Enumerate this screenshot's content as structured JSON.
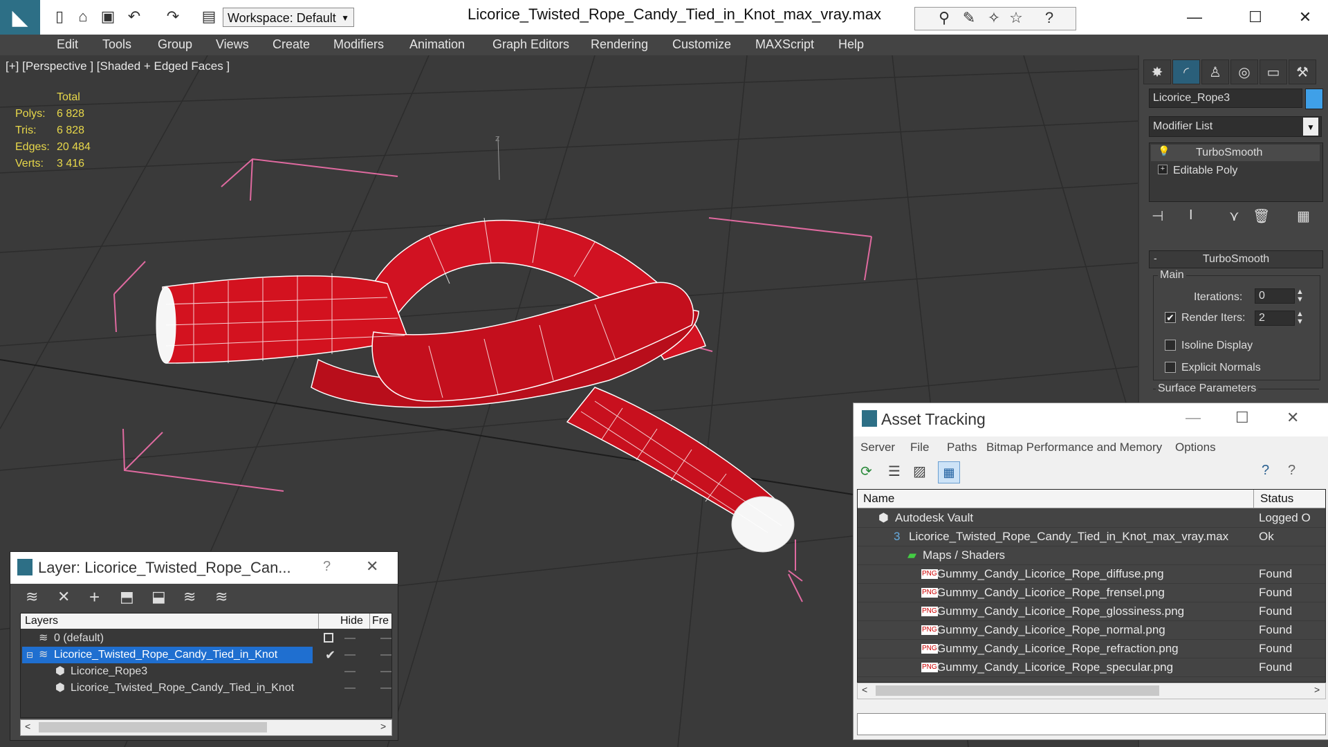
{
  "window": {
    "title": "Licorice_Twisted_Rope_Candy_Tied_in_Knot_max_vray.max",
    "workspace": "Workspace: Default",
    "minimize": "—",
    "maximize": "☐",
    "close": "✕"
  },
  "menu": [
    "Edit",
    "Tools",
    "Group",
    "Views",
    "Create",
    "Modifiers",
    "Animation",
    "Graph Editors",
    "Rendering",
    "Customize",
    "MAXScript",
    "Help"
  ],
  "viewport": {
    "label": "[+] [Perspective ] [Shaded + Edged Faces ]",
    "stats_header": "Total",
    "stats": [
      {
        "label": "Polys:",
        "value": "6 828"
      },
      {
        "label": "Tris:",
        "value": "6 828"
      },
      {
        "label": "Edges:",
        "value": "20 484"
      },
      {
        "label": "Verts:",
        "value": "3 416"
      }
    ],
    "axis_label": "z"
  },
  "command_panel": {
    "object_name": "Licorice_Rope3",
    "modifier_list": "Modifier List",
    "stack": [
      "TurboSmooth",
      "Editable Poly"
    ],
    "rollout_title": "TurboSmooth",
    "group_main": "Main",
    "iterations_label": "Iterations:",
    "iterations_value": "0",
    "render_iters_label": "Render Iters:",
    "render_iters_value": "2",
    "render_iters_checked": "✔",
    "isoline_label": "Isoline Display",
    "explicit_label": "Explicit Normals",
    "surface_label": "Surface Parameters",
    "colors": {
      "swatch": "#3fa0e8"
    }
  },
  "asset_tracking": {
    "title": "Asset Tracking",
    "menu": [
      "Server",
      "File",
      "Paths",
      "Bitmap Performance and Memory",
      "Options"
    ],
    "col_name": "Name",
    "col_status": "Status",
    "rows": [
      {
        "name": "Autodesk Vault",
        "status": "Logged O",
        "indent": 1
      },
      {
        "name": "Licorice_Twisted_Rope_Candy_Tied_in_Knot_max_vray.max",
        "status": "Ok",
        "indent": 2
      },
      {
        "name": "Maps / Shaders",
        "status": "",
        "indent": 3
      },
      {
        "name": "Gummy_Candy_Licorice_Rope_diffuse.png",
        "status": "Found",
        "indent": 4
      },
      {
        "name": "Gummy_Candy_Licorice_Rope_frensel.png",
        "status": "Found",
        "indent": 4
      },
      {
        "name": "Gummy_Candy_Licorice_Rope_glossiness.png",
        "status": "Found",
        "indent": 4
      },
      {
        "name": "Gummy_Candy_Licorice_Rope_normal.png",
        "status": "Found",
        "indent": 4
      },
      {
        "name": "Gummy_Candy_Licorice_Rope_refraction.png",
        "status": "Found",
        "indent": 4
      },
      {
        "name": "Gummy_Candy_Licorice_Rope_specular.png",
        "status": "Found",
        "indent": 4
      }
    ]
  },
  "layer_manager": {
    "title": "Layer: Licorice_Twisted_Rope_Can...",
    "help": "?",
    "close": "✕",
    "col_layers": "Layers",
    "col_hide": "Hide",
    "col_freeze": "Fre",
    "rows": [
      {
        "name": "0 (default)",
        "selected": false,
        "indent": 1
      },
      {
        "name": "Licorice_Twisted_Rope_Candy_Tied_in_Knot",
        "selected": true,
        "indent": 1
      },
      {
        "name": "Licorice_Rope3",
        "selected": false,
        "indent": 2
      },
      {
        "name": "Licorice_Twisted_Rope_Candy_Tied_in_Knot",
        "selected": false,
        "indent": 2
      }
    ]
  }
}
